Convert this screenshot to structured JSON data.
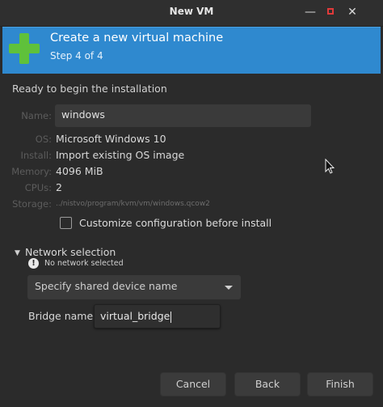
{
  "window": {
    "title": "New VM"
  },
  "banner": {
    "title": "Create a new virtual machine",
    "step": "Step 4 of 4"
  },
  "summary": {
    "heading": "Ready to begin the installation",
    "name_label": "Name:",
    "name_value": "windows",
    "os_label": "OS:",
    "os_value": "Microsoft Windows 10",
    "install_label": "Install:",
    "install_value": "Import existing OS image",
    "memory_label": "Memory:",
    "memory_value": "4096 MiB",
    "cpus_label": "CPUs:",
    "cpus_value": "2",
    "storage_label": "Storage:",
    "storage_value": "../nistvo/program/kvm/vm/windows.qcow2"
  },
  "customize": {
    "label": "Customize configuration before install",
    "checked": false
  },
  "network": {
    "title": "Network selection",
    "warning": "No network selected",
    "dropdown_selected": "Specify shared device name",
    "bridge_label": "Bridge name:",
    "bridge_value": "virtual_bridge"
  },
  "buttons": {
    "cancel": "Cancel",
    "back": "Back",
    "finish": "Finish"
  },
  "colors": {
    "banner": "#2f89cf",
    "plus": "#5fc13b",
    "close": "#e03a3a"
  }
}
